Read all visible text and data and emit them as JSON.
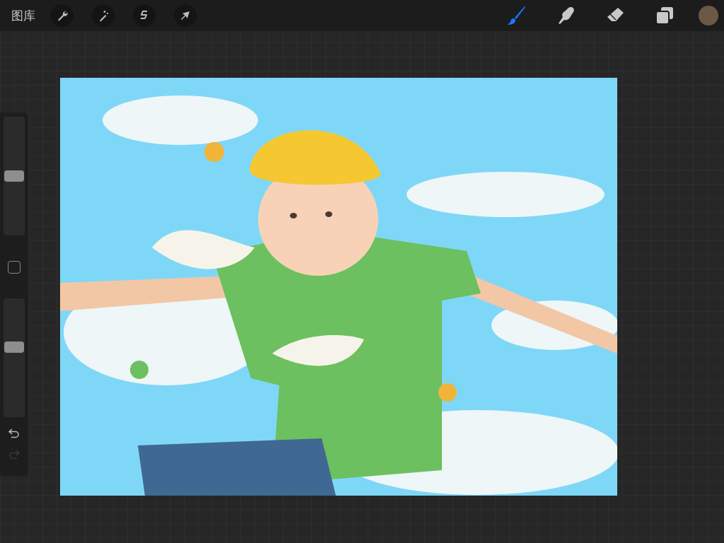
{
  "toolbar": {
    "gallery_label": "图库",
    "left_tools": [
      {
        "kind": "wrench"
      },
      {
        "kind": "wand"
      },
      {
        "kind": "selection"
      },
      {
        "kind": "arrow"
      }
    ],
    "right_tools": [
      {
        "kind": "brush",
        "selected": true
      },
      {
        "kind": "smudge",
        "selected": false
      },
      {
        "kind": "eraser",
        "selected": false
      },
      {
        "kind": "layers",
        "selected": false
      },
      {
        "kind": "color",
        "color": "#6b5845"
      }
    ]
  },
  "sidebar": {
    "size_slider": {
      "level": 0.5
    },
    "opacity_slider": {
      "level": 0.6
    },
    "undo": {
      "disabled": false
    },
    "redo": {
      "disabled": true
    }
  }
}
